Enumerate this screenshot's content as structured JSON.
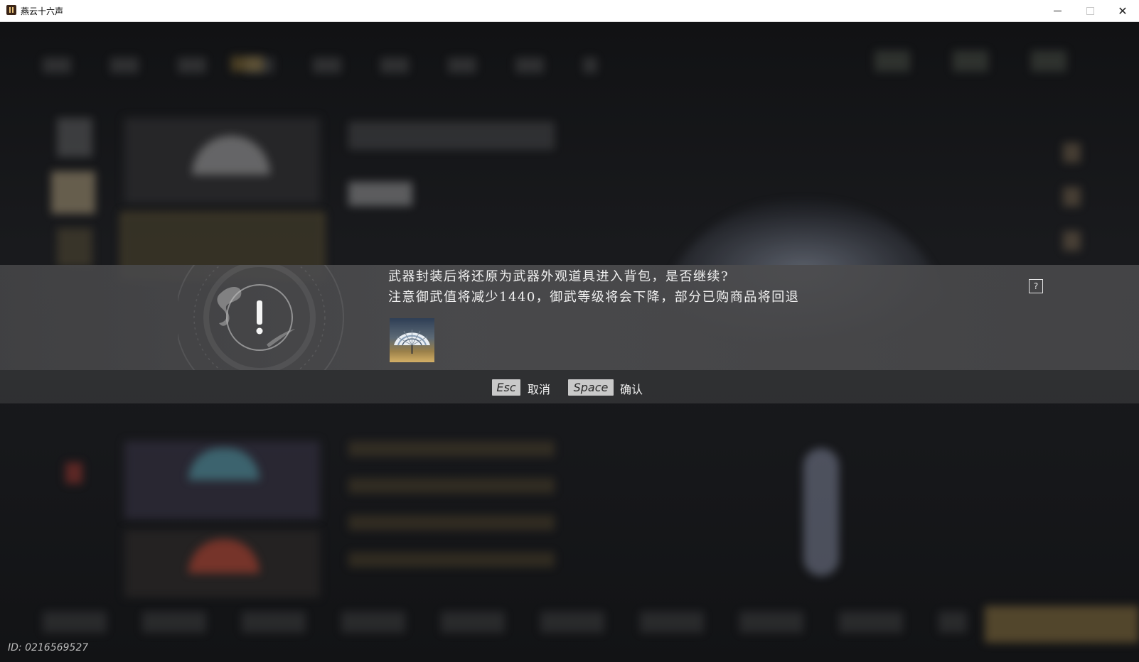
{
  "window": {
    "title": "燕云十六声",
    "minimize_glyph": "─",
    "maximize_glyph": "□",
    "close_glyph": "✕"
  },
  "dialog": {
    "line1": "武器封装后将还原为武器外观道具进入背包，是否继续?",
    "line2": "注意御武值将减少1440，御武等级将会下降，部分已购商品将回退",
    "help_label": "?",
    "emblem_icon": "warning-exclamation-icon",
    "item_icon": "fan-weapon-icon",
    "actions": [
      {
        "key": "Esc",
        "label": "取消"
      },
      {
        "key": "Space",
        "label": "确认"
      }
    ]
  },
  "footer": {
    "player_id": "ID: 0216569527"
  },
  "colors": {
    "overlay_band": "#4c4c4e",
    "keycap": "#c9c9c9",
    "text": "#f2f2f2"
  }
}
